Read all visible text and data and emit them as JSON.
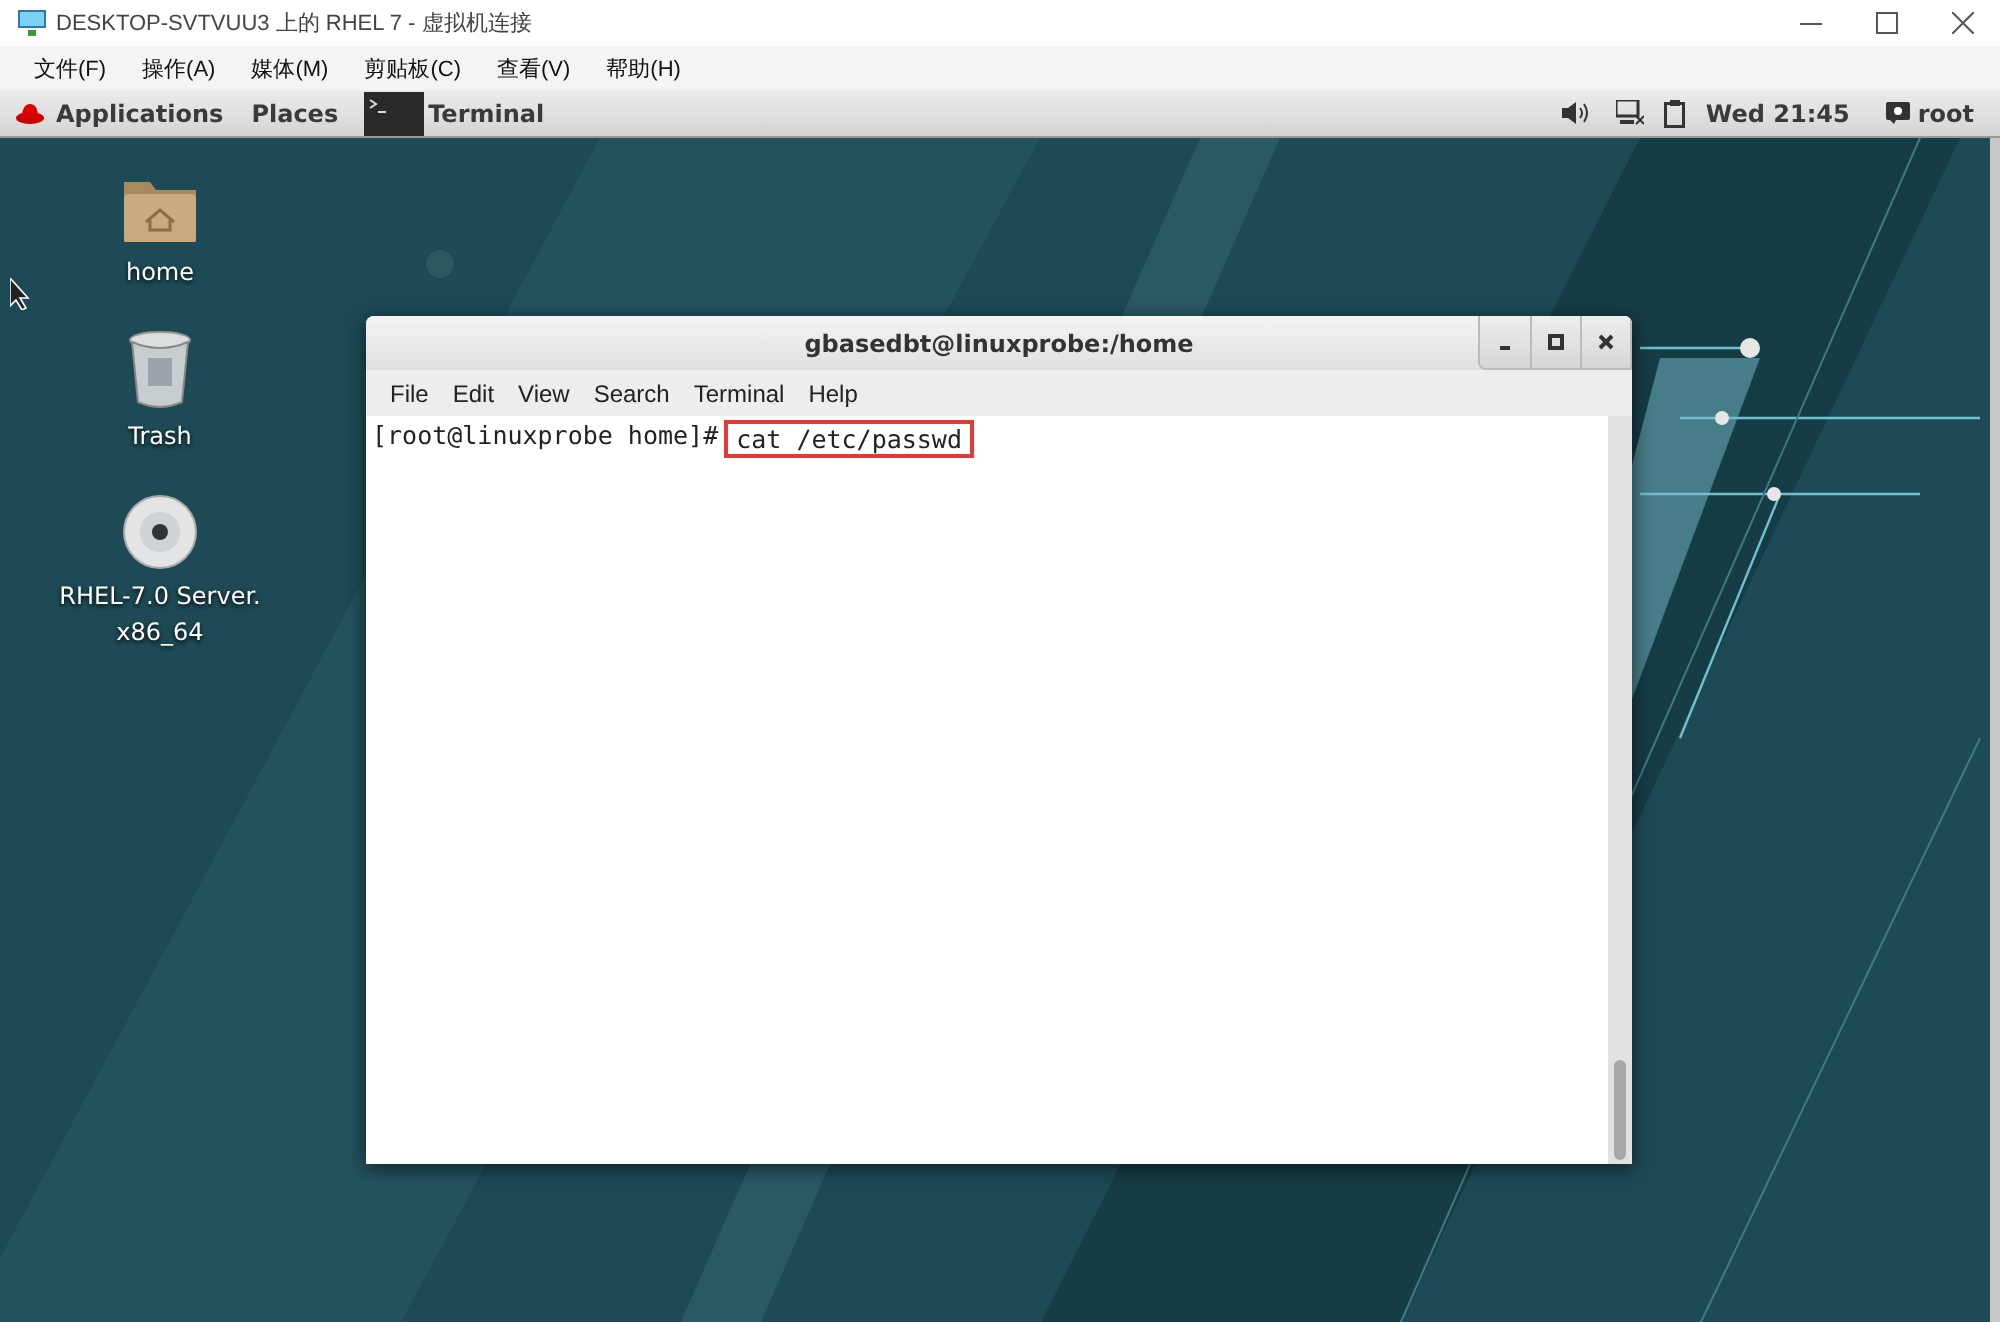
{
  "host_window": {
    "title": "DESKTOP-SVTVUU3 上的 RHEL 7 - 虚拟机连接",
    "menu": [
      "文件(F)",
      "操作(A)",
      "媒体(M)",
      "剪贴板(C)",
      "查看(V)",
      "帮助(H)"
    ]
  },
  "top_bar": {
    "applications": "Applications",
    "places": "Places",
    "task": "Terminal",
    "clock": "Wed 21:45",
    "user": "root"
  },
  "desktop_icons": [
    {
      "label": "home",
      "kind": "folder"
    },
    {
      "label": "Trash",
      "kind": "trash"
    },
    {
      "label": "RHEL-7.0 Server. x86_64",
      "kind": "disc"
    }
  ],
  "terminal": {
    "title": "gbasedbt@linuxprobe:/home",
    "menu": [
      "File",
      "Edit",
      "View",
      "Search",
      "Terminal",
      "Help"
    ],
    "prompt": "[root@linuxprobe home]#",
    "command": "cat /etc/passwd",
    "command_highlighted": true
  }
}
